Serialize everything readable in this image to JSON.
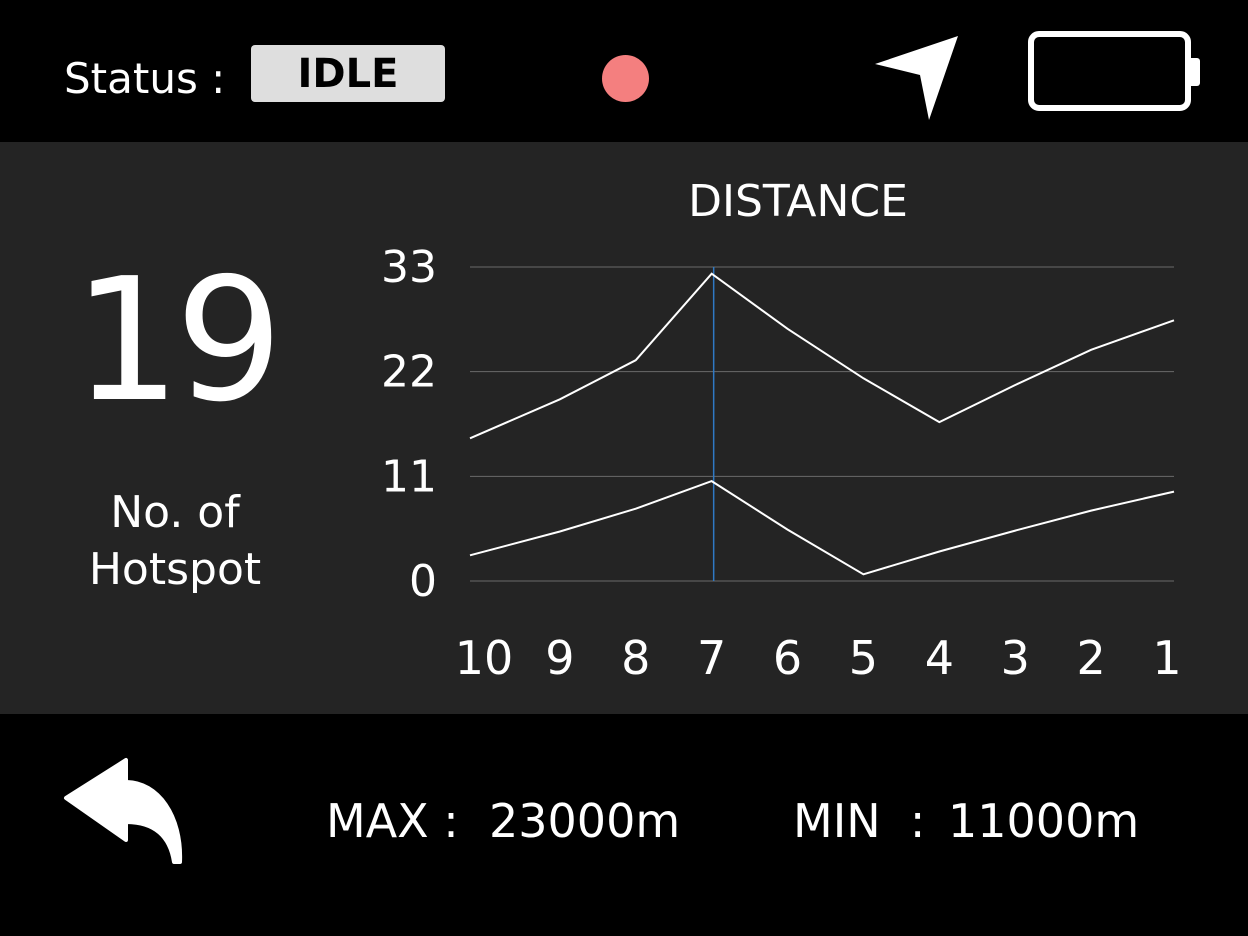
{
  "header": {
    "status_label": "Status :",
    "status_value": "IDLE",
    "recording_color": "#f47f7f",
    "nav_icon": "navigation-arrow-icon",
    "battery_icon": "battery-empty-icon"
  },
  "hotspot": {
    "count": "19",
    "label": "No. of\nHotspot"
  },
  "chart_data": {
    "type": "line",
    "title": "DISTANCE",
    "xlabel": "",
    "ylabel": "",
    "categories": [
      "10",
      "9",
      "8",
      "7",
      "6",
      "5",
      "4",
      "3",
      "2",
      "1"
    ],
    "yticks": [
      0,
      11,
      22,
      33
    ],
    "ylim": [
      0,
      33
    ],
    "grid": true,
    "highlight_category": "7",
    "highlight_color": "#2f79c4",
    "series": [
      {
        "values": [
          15,
          19.1,
          23.2,
          32.3,
          26.5,
          21.3,
          16.7,
          20.6,
          24.3,
          27.4
        ]
      },
      {
        "values": [
          2.7,
          5.2,
          7.6,
          10.5,
          5.4,
          0.7,
          3.1,
          5.3,
          7.4,
          9.4
        ]
      }
    ]
  },
  "footer": {
    "back_icon": "back-arrow-icon",
    "max_label": "MAX :",
    "max_value": "23000m",
    "min_label": "MIN  :",
    "min_value": "11000m"
  }
}
